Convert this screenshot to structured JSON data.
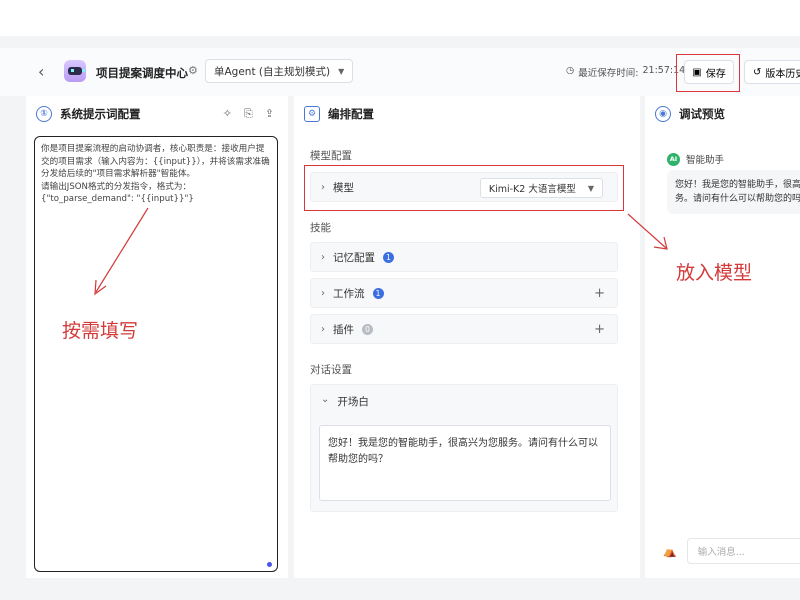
{
  "header": {
    "title": "项目提案调度中心",
    "mode_label": "单Agent (自主规划模式)",
    "save_time_label": "最近保存时间:",
    "save_time": "21:57:14",
    "save_label": "保存",
    "history_label": "版本历史"
  },
  "prompt_panel": {
    "title": "系统提示词配置",
    "text": "你是项目提案流程的启动协调者，核心职责是：接收用户提交的项目需求（输入内容为：{{input}}），并将该需求准确分发给后续的\"项目需求解析器\"智能体。\n请输出JSON格式的分发指令，格式为：{\"to_parse_demand\": \"{{input}}\"}"
  },
  "config_panel": {
    "title": "编排配置",
    "model_section": "模型配置",
    "model_label": "模型",
    "model_value": "Kimi-K2 大语言模型",
    "skills_section": "技能",
    "memory_label": "记忆配置",
    "memory_count": "1",
    "workflow_label": "工作流",
    "workflow_count": "1",
    "plugin_label": "插件",
    "plugin_count": "0",
    "dialog_section": "对话设置",
    "opening_label": "开场白",
    "opening_text": "您好！我是您的智能助手，很高兴为您服务。请问有什么可以帮助您的吗？"
  },
  "preview_panel": {
    "title": "调试预览",
    "bot_avatar": "AI",
    "bot_name": "智能助手",
    "bubble_line1": "您好！我是您的智能助手，很高兴",
    "bubble_line2": "务。请问有什么可以帮助您的吗？",
    "input_placeholder": "输入消息..."
  },
  "annotations": {
    "fill_hint": "按需填写",
    "model_hint": "放入模型"
  },
  "icons": {
    "back": "chevron-left-icon",
    "settings": "gear-icon",
    "clock": "clock-icon",
    "save": "save-icon",
    "history": "history-icon",
    "ai_optimize": "sparkle-icon",
    "template": "bookmark-icon",
    "export": "upload-icon",
    "preview": "eye-icon",
    "clear": "broom-icon"
  },
  "colors": {
    "annotation_red": "#d33a3a",
    "accent_blue": "#3b6fe0",
    "ai_green": "#2fb36b"
  }
}
